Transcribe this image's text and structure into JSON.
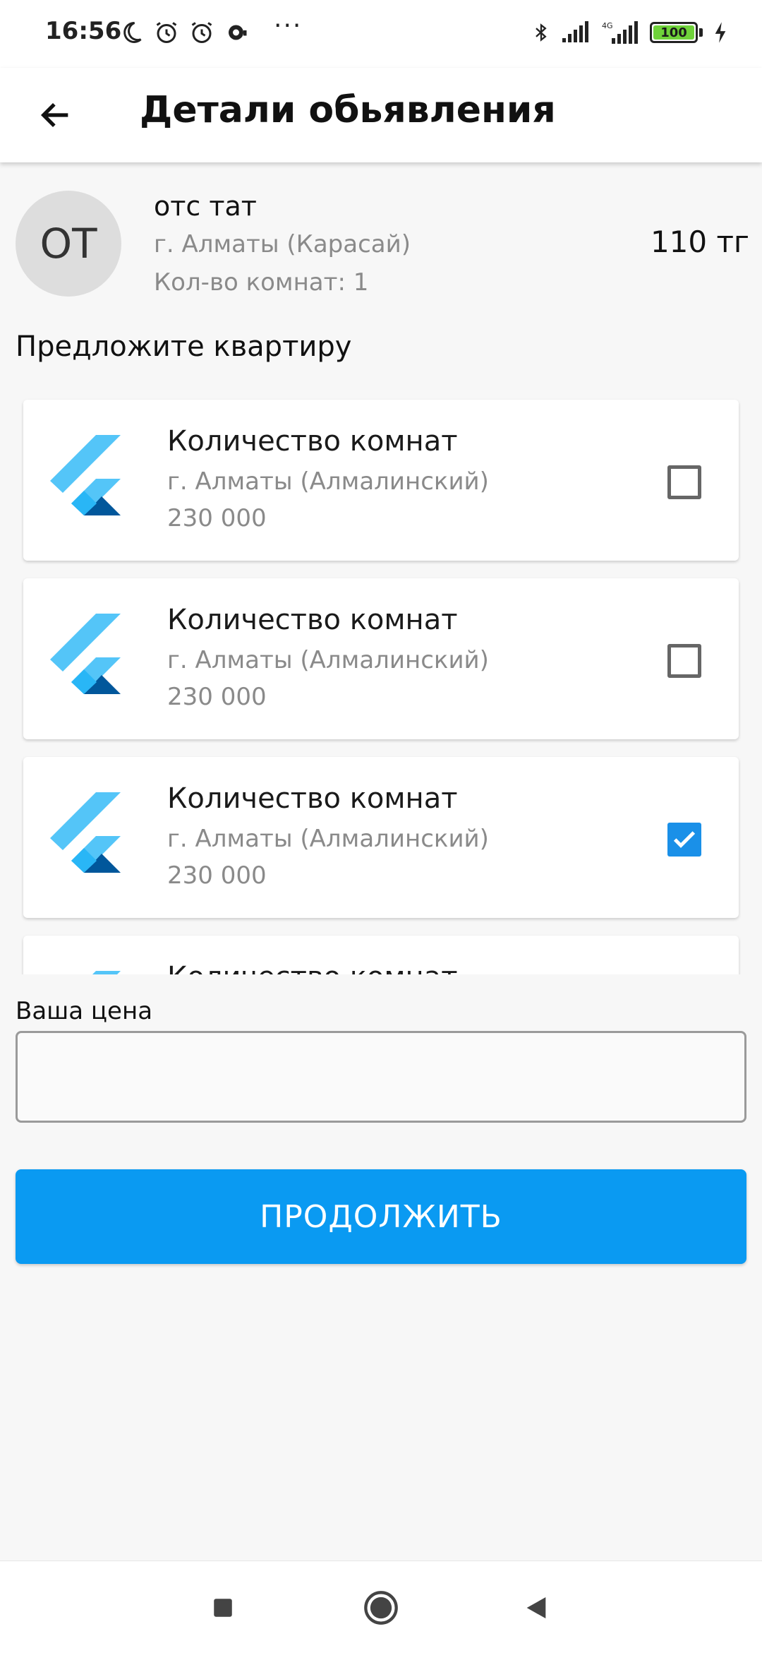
{
  "status_bar": {
    "time": "16:56",
    "dots": "···",
    "battery": "100"
  },
  "app_bar": {
    "title": "Детали обьявления"
  },
  "ad": {
    "avatar_initials": "ОТ",
    "name": "отс тат",
    "location": "г. Алматы (Карасай)",
    "rooms": "Кол-во комнат: 1",
    "price": "110 тг"
  },
  "offer_section": {
    "title": "Предложите квартиру",
    "apartments": [
      {
        "title": "Количество комнат",
        "location": "г. Алматы (Алмалинский)",
        "price": "230 000",
        "checked": false
      },
      {
        "title": "Количество комнат",
        "location": "г. Алматы (Алмалинский)",
        "price": "230 000",
        "checked": false
      },
      {
        "title": "Количество комнат",
        "location": "г. Алматы (Алмалинский)",
        "price": "230 000",
        "checked": true
      },
      {
        "title": "Количество комнат",
        "location": "",
        "price": "",
        "checked": false
      }
    ]
  },
  "price_field": {
    "label": "Ваша цена",
    "value": "",
    "placeholder": ""
  },
  "continue_button": {
    "label": "ПРОДОЛЖИТЬ"
  },
  "colors": {
    "accent": "#0a9af2",
    "checkbox_checked": "#1a90e8",
    "flutter_light": "#54c5f8",
    "flutter_mid": "#29b6f6",
    "flutter_dark": "#01579b"
  }
}
